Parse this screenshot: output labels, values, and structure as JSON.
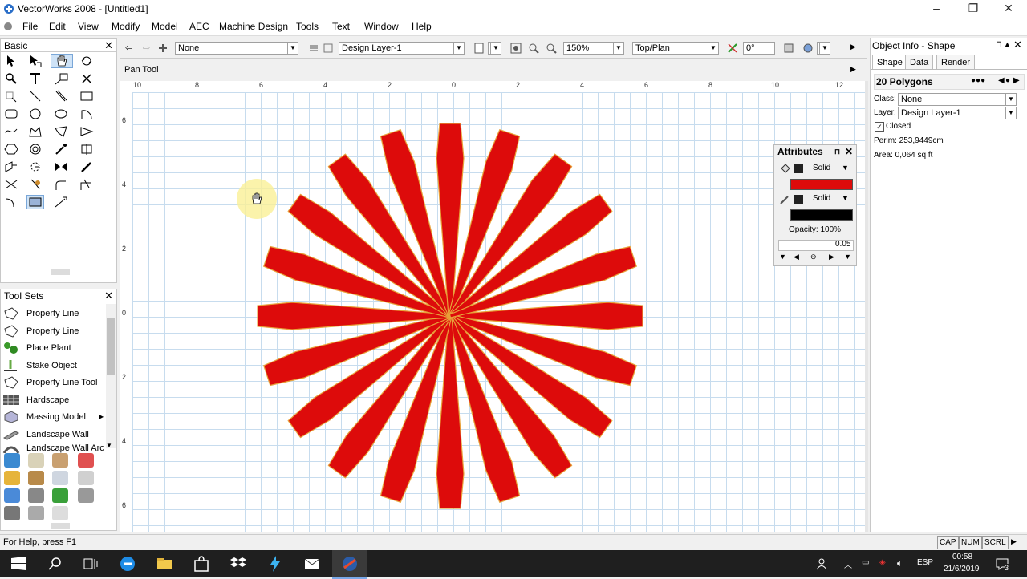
{
  "window": {
    "title": "VectorWorks 2008 - [Untitled1]"
  },
  "menu": [
    "File",
    "Edit",
    "View",
    "Modify",
    "Model",
    "AEC",
    "Machine Design",
    "Tools",
    "Text",
    "Window",
    "Help"
  ],
  "basic_palette": {
    "title": "Basic"
  },
  "tool_sets": {
    "title": "Tool Sets",
    "items": [
      "Property Line",
      "Property Line",
      "Place Plant",
      "Stake Object",
      "Property Line Tool",
      "Hardscape",
      "Massing Model",
      "Landscape Wall",
      "Landscape Wall Arc"
    ]
  },
  "view_bar": {
    "class": "None",
    "layer": "Design Layer-1",
    "zoom": "150%",
    "view": "Top/Plan",
    "rotation": "0°"
  },
  "mode_bar": {
    "tool_label": "Pan Tool"
  },
  "rulers": {
    "top": [
      "10",
      "8",
      "6",
      "4",
      "2",
      "0",
      "2",
      "4",
      "6",
      "8",
      "10",
      "12"
    ],
    "left": [
      "6",
      "4",
      "2",
      "0",
      "2",
      "4",
      "6"
    ]
  },
  "attributes": {
    "title": "Attributes",
    "fill_style": "Solid",
    "fill_color": "#dd0b0b",
    "pen_style": "Solid",
    "pen_color": "#000000",
    "opacity": "Opacity: 100%",
    "line_weight": "0.05"
  },
  "object_info": {
    "title": "Object Info - Shape",
    "tabs": [
      "Shape",
      "Data",
      "Render"
    ],
    "object_name": "20 Polygons",
    "class_label": "Class:",
    "class_value": "None",
    "layer_label": "Layer:",
    "layer_value": "Design Layer-1",
    "closed_label": "Closed",
    "closed": true,
    "perim": "Perim:  253,9449cm",
    "area": "Area:   0,064 sq ft"
  },
  "shape": {
    "fill": "#dd0b0b",
    "stroke": "#e8a23a",
    "rays": 20
  },
  "status": {
    "help": "For Help, press F1",
    "indicators": [
      "CAP",
      "NUM",
      "SCRL"
    ]
  },
  "taskbar": {
    "lang": "ESP",
    "time": "00:58",
    "date": "21/6/2019",
    "notifications": "3"
  }
}
